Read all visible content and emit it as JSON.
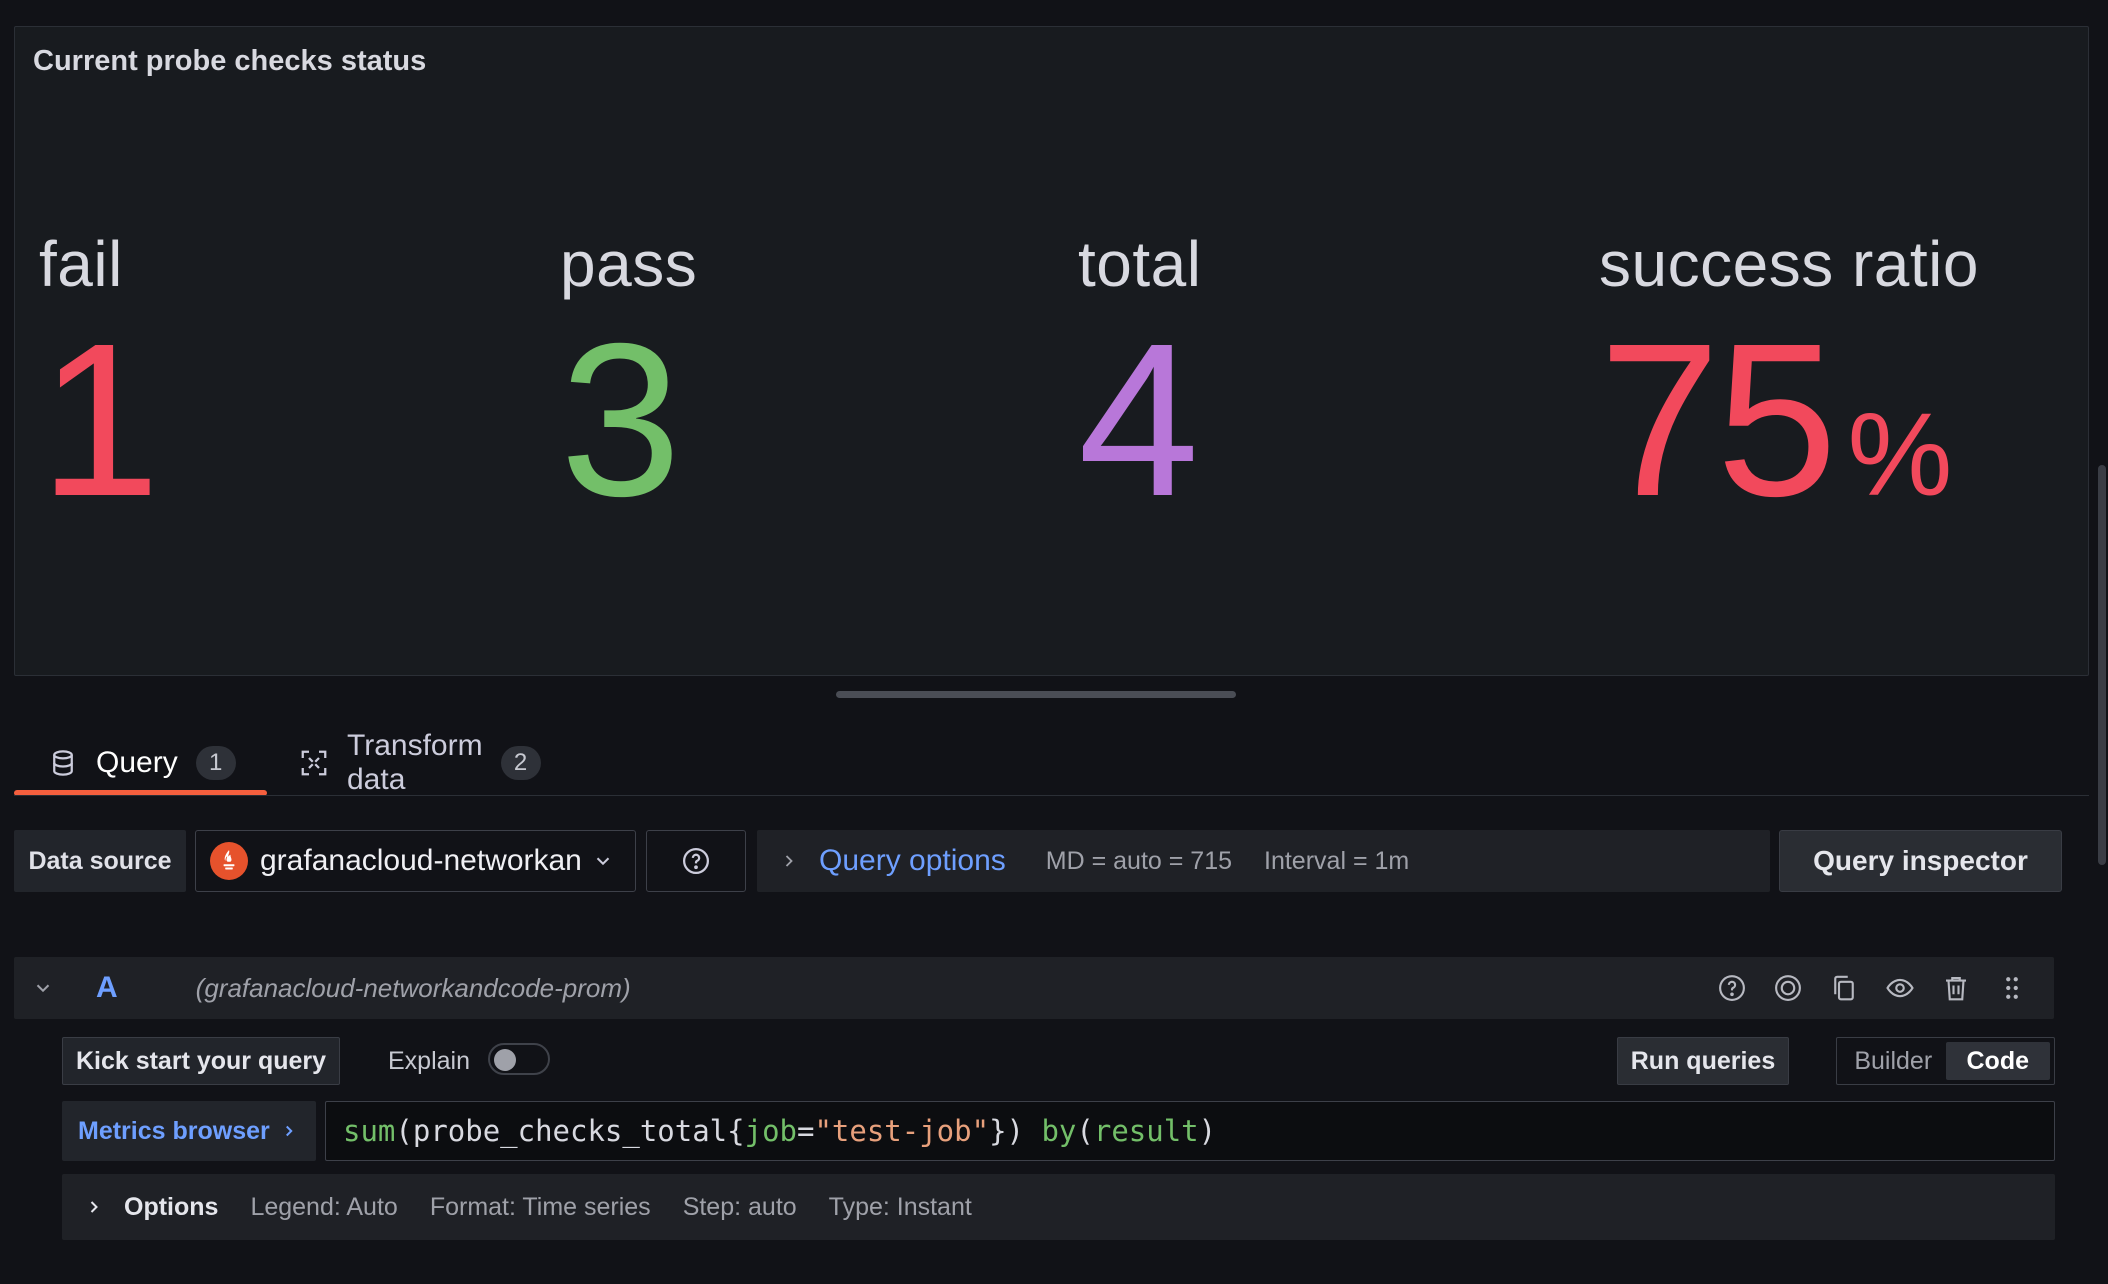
{
  "panel": {
    "title": "Current probe checks status",
    "stats": [
      {
        "label": "fail",
        "value": "1",
        "unit": "",
        "color": "#f2495c"
      },
      {
        "label": "pass",
        "value": "3",
        "unit": "",
        "color": "#73bf69"
      },
      {
        "label": "total",
        "value": "4",
        "unit": "",
        "color": "#b877d9"
      },
      {
        "label": "success ratio",
        "value": "75",
        "unit": "%",
        "color": "#f2495c"
      }
    ]
  },
  "tabs": [
    {
      "label": "Query",
      "count": "1",
      "icon": "database-icon",
      "active": true
    },
    {
      "label": "Transform data",
      "count": "2",
      "icon": "transform-icon",
      "active": false
    }
  ],
  "datasource": {
    "label": "Data source",
    "selected": "grafanacloud-networkandcode-prom",
    "icon": "prometheus-icon"
  },
  "query_options": {
    "title": "Query options",
    "md": "MD = auto = 715",
    "interval": "Interval = 1m"
  },
  "query_inspector_label": "Query inspector",
  "query": {
    "ref_id": "A",
    "datasource_hint": "(grafanacloud-networkandcode-prom)",
    "kick_start_label": "Kick start your query",
    "explain_label": "Explain",
    "explain_enabled": false,
    "run_label": "Run queries",
    "modes": [
      {
        "label": "Builder",
        "active": false
      },
      {
        "label": "Code",
        "active": true
      }
    ],
    "metrics_browser_label": "Metrics browser",
    "expr_tokens": [
      {
        "t": "sum",
        "k": "fn"
      },
      {
        "t": "(",
        "k": "punc"
      },
      {
        "t": "probe_checks_total",
        "k": "punc"
      },
      {
        "t": "{",
        "k": "punc"
      },
      {
        "t": "job",
        "k": "lbl"
      },
      {
        "t": "=",
        "k": "punc"
      },
      {
        "t": "\"test-job\"",
        "k": "str"
      },
      {
        "t": "})",
        "k": "punc"
      },
      {
        "t": " ",
        "k": "punc"
      },
      {
        "t": "by",
        "k": "fn"
      },
      {
        "t": "(",
        "k": "punc"
      },
      {
        "t": "result",
        "k": "lbl"
      },
      {
        "t": ")",
        "k": "punc"
      }
    ],
    "options": {
      "title": "Options",
      "legend": "Legend: Auto",
      "format": "Format: Time series",
      "step": "Step: auto",
      "type": "Type: Instant"
    }
  },
  "colors": {
    "accent": "#6e9fff",
    "tab_underline": "#f55f3e",
    "background": "#111217"
  }
}
